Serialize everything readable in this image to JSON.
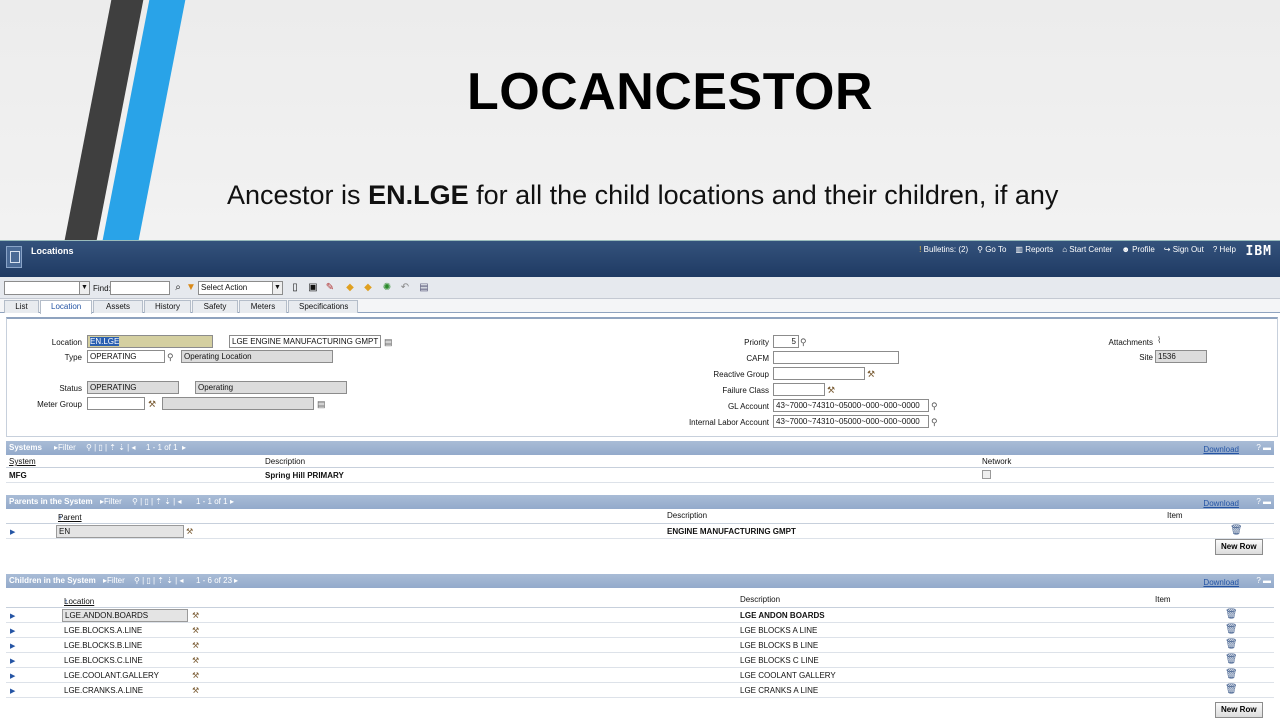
{
  "slide": {
    "title": "LOCANCESTOR",
    "subtitle_pre": "Ancestor is ",
    "subtitle_bold": "EN.LGE",
    "subtitle_post": " for all the child locations and their children, if any"
  },
  "app": {
    "title": "Locations",
    "nav": {
      "bulletins": "Bulletins: (2)",
      "goto": "Go To",
      "reports": "Reports",
      "start_center": "Start Center",
      "profile": "Profile",
      "sign_out": "Sign Out",
      "help": "Help"
    },
    "brand": "IBM"
  },
  "toolbar": {
    "find_label": "Find:",
    "find_value": "",
    "select_action": "Select Action"
  },
  "tabs": [
    "List",
    "Location",
    "Assets",
    "History",
    "Safety",
    "Meters",
    "Specifications"
  ],
  "active_tab": "Location",
  "form": {
    "location_label": "Location",
    "location_value": "EN.LGE",
    "location_desc": "LGE ENGINE MANUFACTURING GMPT",
    "type_label": "Type",
    "type_value": "OPERATING",
    "type_desc": "Operating Location",
    "status_label": "Status",
    "status_value": "OPERATING",
    "status_desc": "Operating",
    "meter_group_label": "Meter Group",
    "priority_label": "Priority",
    "priority_value": "5",
    "cafm_label": "CAFM",
    "reactive_group_label": "Reactive Group",
    "failure_class_label": "Failure Class",
    "gl_account_label": "GL Account",
    "gl_account_value": "43~7000~74310~05000~000~000~0000",
    "internal_labor_label": "Internal Labor Account",
    "internal_labor_value": "43~7000~74310~05000~000~000~0000",
    "attachments_label": "Attachments",
    "site_label": "Site",
    "site_value": "1536"
  },
  "systems": {
    "title": "Systems",
    "filter": "Filter",
    "range": "1 - 1 of 1",
    "download": "Download",
    "columns": [
      "System",
      "Description",
      "Network"
    ],
    "rows": [
      {
        "system": "MFG",
        "description": "Spring Hill PRIMARY"
      }
    ]
  },
  "parents": {
    "title": "Parents in the System",
    "filter": "Filter",
    "range": "1 - 1 of 1",
    "download": "Download",
    "columns": [
      "Parent",
      "Description",
      "Item"
    ],
    "rows": [
      {
        "parent": "EN",
        "description": "ENGINE MANUFACTURING GMPT"
      }
    ],
    "new_row": "New Row"
  },
  "children": {
    "title": "Children in the System",
    "filter": "Filter",
    "range": "1 - 6 of 23",
    "download": "Download",
    "columns": [
      "Location",
      "Description",
      "Item"
    ],
    "rows": [
      {
        "location": "LGE.ANDON.BOARDS",
        "description": "LGE ANDON BOARDS"
      },
      {
        "location": "LGE.BLOCKS.A.LINE",
        "description": "LGE BLOCKS A LINE"
      },
      {
        "location": "LGE.BLOCKS.B.LINE",
        "description": "LGE BLOCKS B LINE"
      },
      {
        "location": "LGE.BLOCKS.C.LINE",
        "description": "LGE BLOCKS C LINE"
      },
      {
        "location": "LGE.COOLANT.GALLERY",
        "description": "LGE COOLANT GALLERY"
      },
      {
        "location": "LGE.CRANKS.A.LINE",
        "description": "LGE CRANKS A LINE"
      }
    ],
    "new_row": "New Row"
  },
  "colors": {
    "topbar": "#1f3a63",
    "section_header": "#93aacb",
    "accent_blue": "#29a3e8",
    "link": "#2454a4"
  }
}
